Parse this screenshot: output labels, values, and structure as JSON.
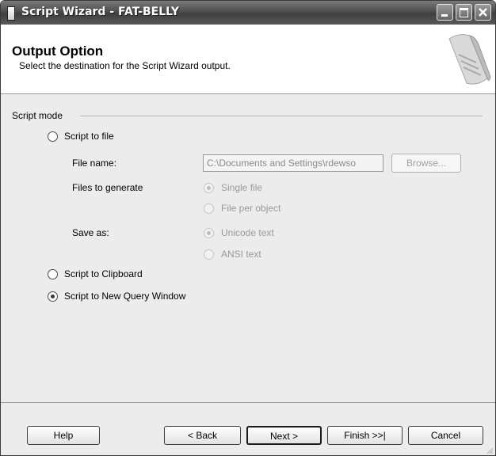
{
  "window": {
    "title": "Script Wizard - FAT-BELLY"
  },
  "header": {
    "title": "Output Option",
    "subtitle": "Select the destination for the Script Wizard output."
  },
  "script_mode": {
    "group_label": "Script mode",
    "options": {
      "to_file": {
        "label": "Script to file",
        "checked": false
      },
      "to_clipboard": {
        "label": "Script to Clipboard",
        "checked": false
      },
      "to_new_query_window": {
        "label": "Script to New Query Window",
        "checked": true
      }
    },
    "file_name": {
      "label": "File name:",
      "value": "C:\\Documents and Settings\\rdewso",
      "browse_label": "Browse..."
    },
    "files_to_generate": {
      "label": "Files to generate",
      "options": [
        "Single file",
        "File per object"
      ],
      "selected": "Single file"
    },
    "save_as": {
      "label": "Save as:",
      "options": [
        "Unicode text",
        "ANSI text"
      ],
      "selected": "Unicode text"
    }
  },
  "footer": {
    "help": "Help",
    "back": "< Back",
    "next": "Next >",
    "finish": "Finish >>|",
    "cancel": "Cancel"
  }
}
